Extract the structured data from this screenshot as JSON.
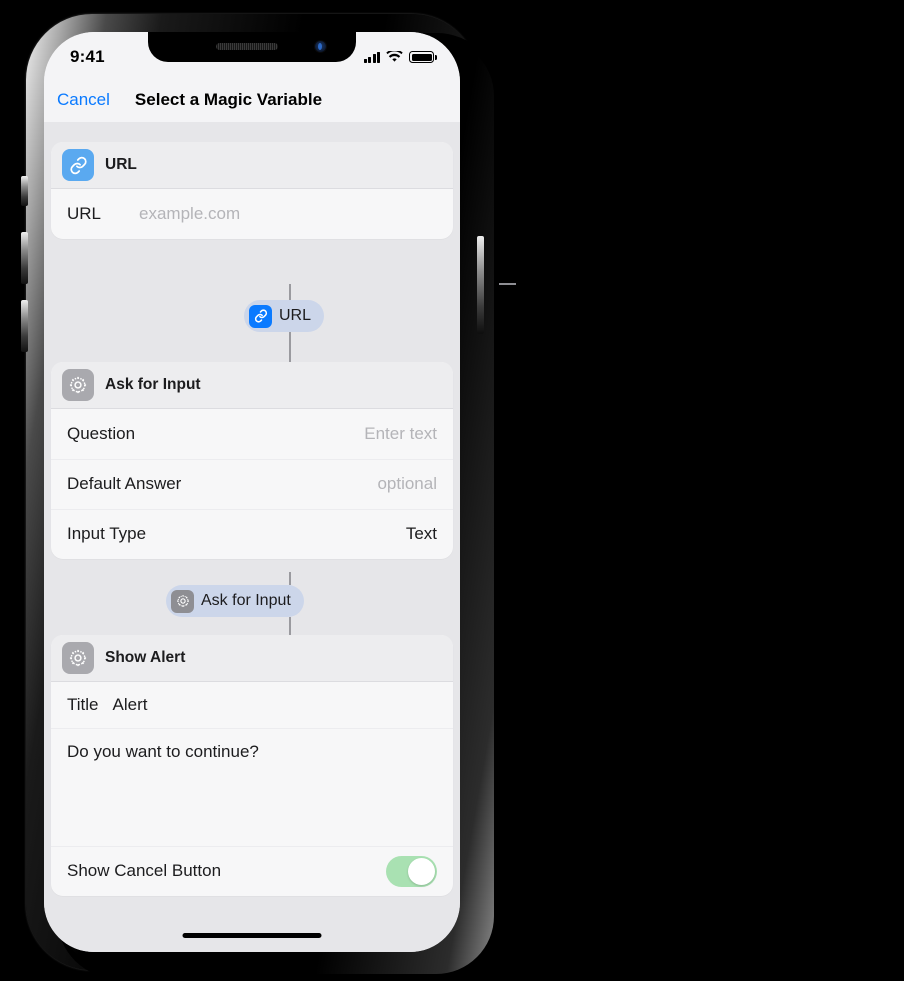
{
  "status_bar": {
    "time": "9:41",
    "signal_icon": "cellular-bars-icon",
    "wifi_icon": "wifi-icon",
    "battery_icon": "battery-full-icon"
  },
  "nav": {
    "cancel_label": "Cancel",
    "title": "Select a Magic Variable"
  },
  "cards": {
    "url": {
      "icon_name": "link-icon",
      "icon_color": "#5aa9f0",
      "header_label": "URL",
      "row_label": "URL",
      "row_placeholder": "example.com"
    },
    "ask_for_input": {
      "icon_name": "gear-icon",
      "icon_color": "#a9a9ae",
      "header_label": "Ask for Input",
      "rows": [
        {
          "label": "Question",
          "value": "Enter text",
          "is_placeholder": true
        },
        {
          "label": "Default Answer",
          "value": "optional",
          "is_placeholder": true
        },
        {
          "label": "Input Type",
          "value": "Text",
          "is_placeholder": false
        }
      ]
    },
    "show_alert": {
      "icon_name": "gear-icon",
      "icon_color": "#a9a9ae",
      "header_label": "Show Alert",
      "title_label": "Title",
      "title_value": "Alert",
      "message": "Do you want to continue?",
      "cancel_row_label": "Show Cancel Button",
      "cancel_toggle_on": true,
      "toggle_color": "#a9e1b2"
    }
  },
  "tokens": {
    "url": {
      "label": "URL",
      "icon_name": "link-icon",
      "icon_color": "#0a7aff"
    },
    "ask_for_input": {
      "label": "Ask for Input",
      "icon_name": "gear-icon",
      "icon_color": "#8e8e93"
    }
  },
  "colors": {
    "accent_blue": "#0a7aff",
    "screen_background": "#e6e6e9",
    "card_background": "#f7f7f8",
    "token_background": "#ccd6ea",
    "callout_line": "#8e8e93"
  }
}
